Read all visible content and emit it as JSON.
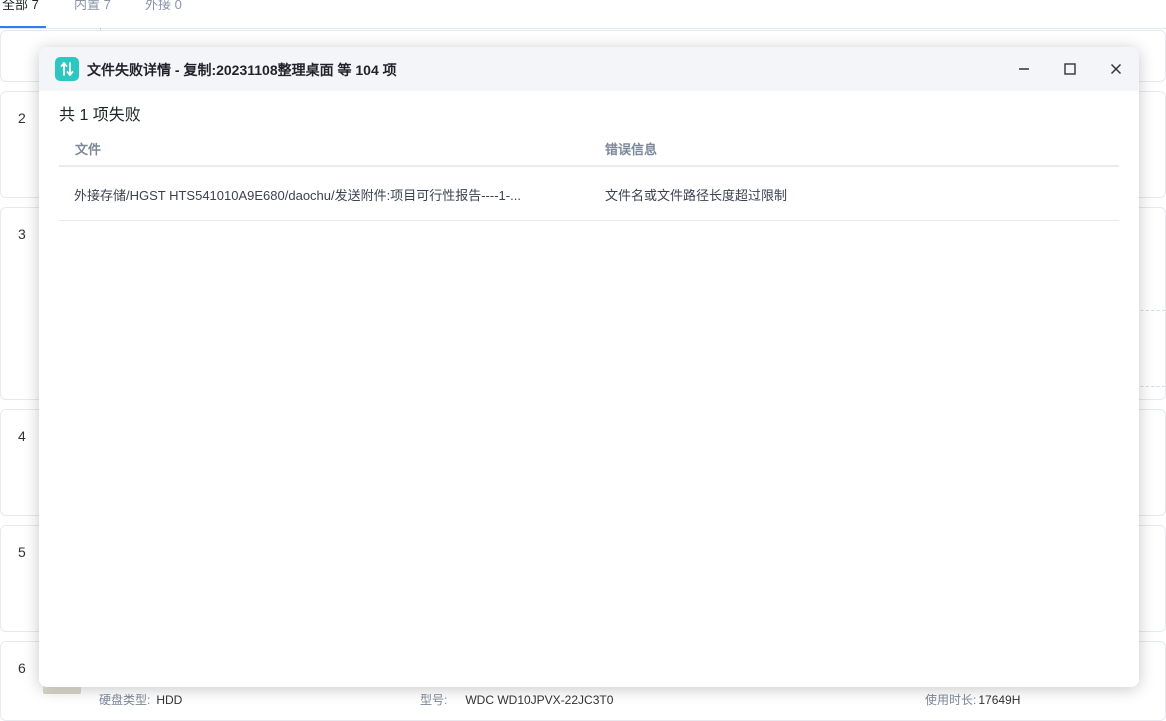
{
  "background": {
    "tabs": [
      {
        "label": "全部 7"
      },
      {
        "label": "内置 7"
      },
      {
        "label": "外接 0"
      }
    ],
    "rows": [
      {
        "number": "2"
      },
      {
        "number": "3"
      },
      {
        "number": "4"
      },
      {
        "number": "5"
      },
      {
        "number": "6"
      }
    ],
    "bottom": {
      "disk_type_label": "硬盘类型:",
      "disk_type_value": "HDD",
      "model_label": "型号:",
      "model_value": "WDC WD10JPVX-22JC3T0",
      "usage_label": "使用时长:",
      "usage_value": "17649H"
    }
  },
  "dialog": {
    "title": "文件失败详情 - 复制:20231108整理桌面 等 104 项",
    "summary": "共 1 项失败",
    "columns": {
      "file": "文件",
      "error": "错误信息"
    },
    "rows": [
      {
        "file": "外接存储/HGST HTS541010A9E680/daochu/发送附件:项目可行性报告----1-...",
        "error": "文件名或文件路径长度超过限制"
      }
    ],
    "buttons": {
      "minimize": "minimize-icon",
      "maximize": "maximize-icon",
      "close": "close-icon"
    }
  },
  "colors": {
    "accent": "#2f7cf6",
    "app_icon": "#2cc7c1",
    "titlebar_bg": "#f3f5f8"
  }
}
